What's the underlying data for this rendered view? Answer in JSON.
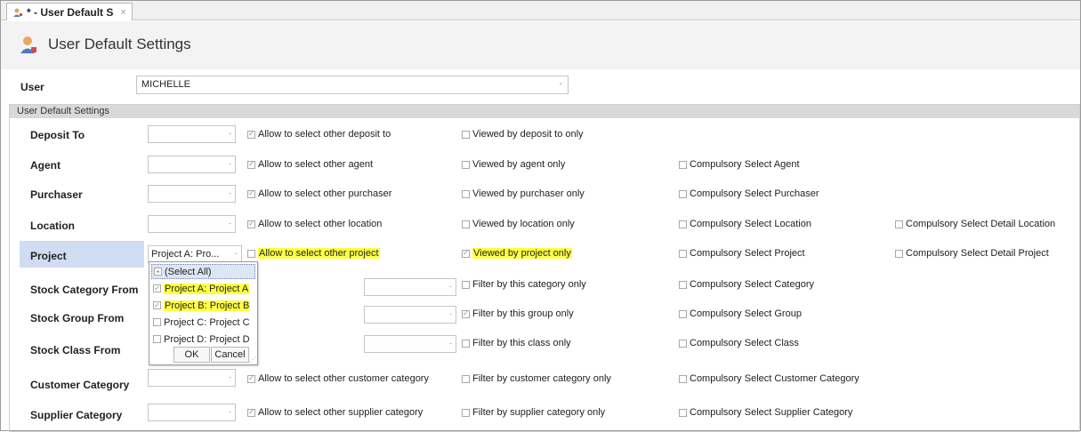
{
  "tab": {
    "label": "* - User Default S",
    "close": "×"
  },
  "header": {
    "title": "User Default Settings"
  },
  "user": {
    "label": "User",
    "value": "MICHELLE",
    "arrow": "-"
  },
  "group": {
    "title": "User Default Settings"
  },
  "rows": {
    "deposit": {
      "label": "Deposit To",
      "allow": "Allow to select other deposit to",
      "viewed": "Viewed by deposit to only"
    },
    "agent": {
      "label": "Agent",
      "allow": "Allow to select other agent",
      "viewed": "Viewed by agent only",
      "compulsory": "Compulsory Select Agent"
    },
    "purchaser": {
      "label": "Purchaser",
      "allow": "Allow to select other purchaser",
      "viewed": "Viewed by purchaser only",
      "compulsory": "Compulsory Select Purchaser"
    },
    "location": {
      "label": "Location",
      "allow": "Allow to select other location",
      "viewed": "Viewed by location only",
      "compulsory": "Compulsory Select Location",
      "detail": "Compulsory Select Detail Location"
    },
    "project": {
      "label": "Project",
      "value": "Project A: Pro...",
      "allow": "Allow to select other project",
      "viewed": "Viewed by project only",
      "compulsory": "Compulsory Select Project",
      "detail": "Compulsory Select Detail Project"
    },
    "stock_category": {
      "label": "Stock Category From",
      "filter": "Filter by this category only",
      "compulsory": "Compulsory Select Category"
    },
    "stock_group": {
      "label": "Stock Group From",
      "filter": "Filter by this group only",
      "compulsory": "Compulsory Select Group"
    },
    "stock_class": {
      "label": "Stock Class From",
      "filter": "Filter by this class only",
      "compulsory": "Compulsory Select Class"
    },
    "customer_category": {
      "label": "Customer Category",
      "allow": "Allow to select other customer category",
      "filter": "Filter by customer category only",
      "compulsory": "Compulsory Select Customer Category"
    },
    "supplier_category": {
      "label": "Supplier Category",
      "allow": "Allow to select other supplier category",
      "filter": "Filter by supplier category only",
      "compulsory": "Compulsory Select Supplier Category"
    }
  },
  "dropdown": {
    "select_all": "(Select All)",
    "items": [
      "Project A: Project A",
      "Project B: Project B",
      "Project C: Project C",
      "Project D: Project D"
    ],
    "ok": "OK",
    "cancel": "Cancel"
  },
  "colors": {
    "highlight": "#ffff44",
    "selected_row": "#cfdcf2",
    "group_title_bg": "#d9d9d9"
  }
}
